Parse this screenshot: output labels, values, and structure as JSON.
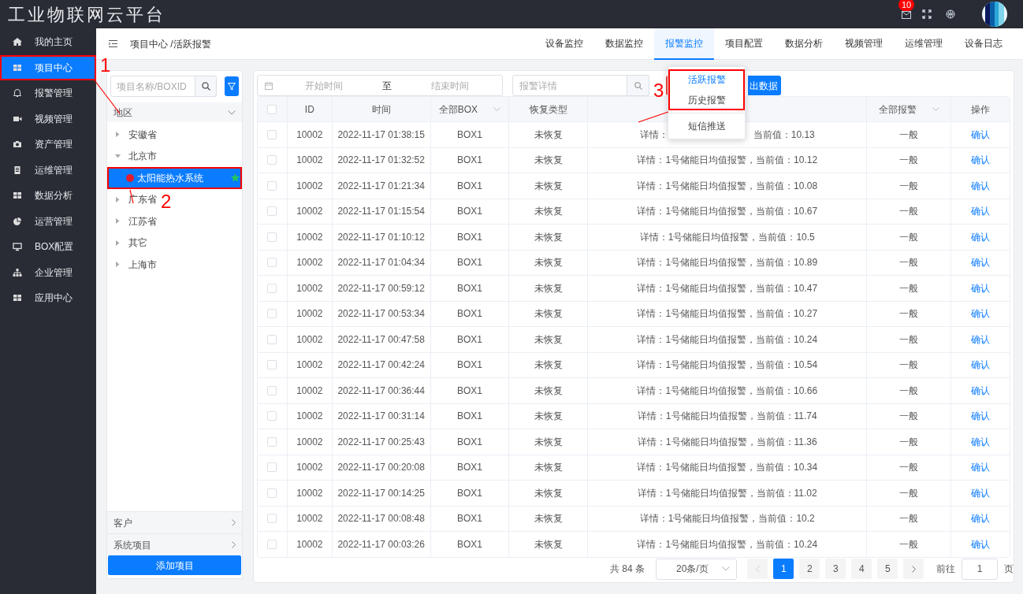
{
  "app_title": "工业物联网云平台",
  "header_icons": {
    "mail_badge": "10"
  },
  "sidebar": {
    "items": [
      {
        "label": "我的主页",
        "selected": false
      },
      {
        "label": "项目中心",
        "selected": true
      },
      {
        "label": "报警管理",
        "selected": false
      },
      {
        "label": "视频管理",
        "selected": false
      },
      {
        "label": "资产管理",
        "selected": false
      },
      {
        "label": "运维管理",
        "selected": false
      },
      {
        "label": "数据分析",
        "selected": false
      },
      {
        "label": "运营管理",
        "selected": false
      },
      {
        "label": "BOX配置",
        "selected": false
      },
      {
        "label": "企业管理",
        "selected": false
      },
      {
        "label": "应用中心",
        "selected": false
      }
    ]
  },
  "breadcrumb": "项目中心 /活跃报警",
  "tabs": [
    {
      "label": "设备监控",
      "selected": false
    },
    {
      "label": "数据监控",
      "selected": false
    },
    {
      "label": "报警监控",
      "selected": true
    },
    {
      "label": "项目配置",
      "selected": false
    },
    {
      "label": "数据分析",
      "selected": false
    },
    {
      "label": "视频管理",
      "selected": false
    },
    {
      "label": "运维管理",
      "selected": false
    },
    {
      "label": "设备日志",
      "selected": false
    }
  ],
  "project_panel": {
    "search": {
      "placeholder": "项目名称/BOXID"
    },
    "region_header": "地区",
    "tree": [
      {
        "label": "安徽省",
        "expanded": false
      },
      {
        "label": "北京市",
        "expanded": true,
        "children": [
          {
            "label": "太阳能热水系统",
            "selected": true,
            "alert": true,
            "starred": true
          }
        ]
      },
      {
        "label": "广东省",
        "expanded": false
      },
      {
        "label": "江苏省",
        "expanded": false
      },
      {
        "label": "其它",
        "expanded": false
      },
      {
        "label": "上海市",
        "expanded": false
      }
    ],
    "sections": [
      "客户",
      "系统项目"
    ],
    "add_button": "添加项目"
  },
  "filters": {
    "start_placeholder": "开始时间",
    "separator": "至",
    "end_placeholder": "结束时间",
    "detail_placeholder": "报警详情",
    "export_button": "出数据"
  },
  "dropdown": {
    "items": [
      {
        "label": "活跃报警",
        "selected": true
      },
      {
        "label": "历史报警",
        "selected": false
      },
      {
        "label": "短信推送",
        "selected": false
      }
    ]
  },
  "table": {
    "header_checked": false,
    "columns": [
      "ID",
      "时间",
      "全部BOX",
      "恢复类型",
      "",
      "全部报警",
      "操作"
    ],
    "rows": [
      {
        "checked": false,
        "id": "10002",
        "time": "2022-11-17 01:38:15",
        "box": "BOX1",
        "recovery": "未恢复",
        "detail": "详情：",
        "detail_end": "当前值：10.13",
        "level": "一般",
        "action": "确认"
      },
      {
        "checked": false,
        "id": "10002",
        "time": "2022-11-17 01:32:52",
        "box": "BOX1",
        "recovery": "未恢复",
        "detail": "详情：1号储能日均值报警，当前值：10.12",
        "level": "一般",
        "action": "确认"
      },
      {
        "checked": false,
        "id": "10002",
        "time": "2022-11-17 01:21:34",
        "box": "BOX1",
        "recovery": "未恢复",
        "detail": "详情：1号储能日均值报警，当前值：10.08",
        "level": "一般",
        "action": "确认"
      },
      {
        "checked": false,
        "id": "10002",
        "time": "2022-11-17 01:15:54",
        "box": "BOX1",
        "recovery": "未恢复",
        "detail": "详情：1号储能日均值报警，当前值：10.67",
        "level": "一般",
        "action": "确认"
      },
      {
        "checked": false,
        "id": "10002",
        "time": "2022-11-17 01:10:12",
        "box": "BOX1",
        "recovery": "未恢复",
        "detail": "详情：1号储能日均值报警，当前值：10.5",
        "level": "一般",
        "action": "确认"
      },
      {
        "checked": false,
        "id": "10002",
        "time": "2022-11-17 01:04:34",
        "box": "BOX1",
        "recovery": "未恢复",
        "detail": "详情：1号储能日均值报警，当前值：10.89",
        "level": "一般",
        "action": "确认"
      },
      {
        "checked": false,
        "id": "10002",
        "time": "2022-11-17 00:59:12",
        "box": "BOX1",
        "recovery": "未恢复",
        "detail": "详情：1号储能日均值报警，当前值：10.47",
        "level": "一般",
        "action": "确认"
      },
      {
        "checked": false,
        "id": "10002",
        "time": "2022-11-17 00:53:34",
        "box": "BOX1",
        "recovery": "未恢复",
        "detail": "详情：1号储能日均值报警，当前值：10.27",
        "level": "一般",
        "action": "确认"
      },
      {
        "checked": false,
        "id": "10002",
        "time": "2022-11-17 00:47:58",
        "box": "BOX1",
        "recovery": "未恢复",
        "detail": "详情：1号储能日均值报警，当前值：10.24",
        "level": "一般",
        "action": "确认"
      },
      {
        "checked": false,
        "id": "10002",
        "time": "2022-11-17 00:42:24",
        "box": "BOX1",
        "recovery": "未恢复",
        "detail": "详情：1号储能日均值报警，当前值：10.54",
        "level": "一般",
        "action": "确认"
      },
      {
        "checked": false,
        "id": "10002",
        "time": "2022-11-17 00:36:44",
        "box": "BOX1",
        "recovery": "未恢复",
        "detail": "详情：1号储能日均值报警，当前值：10.66",
        "level": "一般",
        "action": "确认"
      },
      {
        "checked": false,
        "id": "10002",
        "time": "2022-11-17 00:31:14",
        "box": "BOX1",
        "recovery": "未恢复",
        "detail": "详情：1号储能日均值报警，当前值：11.74",
        "level": "一般",
        "action": "确认"
      },
      {
        "checked": false,
        "id": "10002",
        "time": "2022-11-17 00:25:43",
        "box": "BOX1",
        "recovery": "未恢复",
        "detail": "详情：1号储能日均值报警，当前值：11.36",
        "level": "一般",
        "action": "确认"
      },
      {
        "checked": false,
        "id": "10002",
        "time": "2022-11-17 00:20:08",
        "box": "BOX1",
        "recovery": "未恢复",
        "detail": "详情：1号储能日均值报警，当前值：10.34",
        "level": "一般",
        "action": "确认"
      },
      {
        "checked": false,
        "id": "10002",
        "time": "2022-11-17 00:14:25",
        "box": "BOX1",
        "recovery": "未恢复",
        "detail": "详情：1号储能日均值报警，当前值：11.02",
        "level": "一般",
        "action": "确认"
      },
      {
        "checked": false,
        "id": "10002",
        "time": "2022-11-17 00:08:48",
        "box": "BOX1",
        "recovery": "未恢复",
        "detail": "详情：1号储能日均值报警，当前值：10.2",
        "level": "一般",
        "action": "确认"
      },
      {
        "checked": false,
        "id": "10002",
        "time": "2022-11-17 00:03:26",
        "box": "BOX1",
        "recovery": "未恢复",
        "detail": "详情：1号储能日均值报警，当前值：10.24",
        "level": "一般",
        "action": "确认"
      }
    ]
  },
  "pagination": {
    "total": "共 84 条",
    "page_size": "20条/页",
    "pages": [
      {
        "label": "1",
        "selected": true
      },
      {
        "label": "2",
        "selected": false
      },
      {
        "label": "3",
        "selected": false
      },
      {
        "label": "4",
        "selected": false
      },
      {
        "label": "5",
        "selected": false
      }
    ],
    "goto_label": "前往",
    "goto_value": "1",
    "page_suffix": "页"
  },
  "annotations": [
    {
      "label": "1"
    },
    {
      "label": "2"
    },
    {
      "label": "3"
    }
  ]
}
